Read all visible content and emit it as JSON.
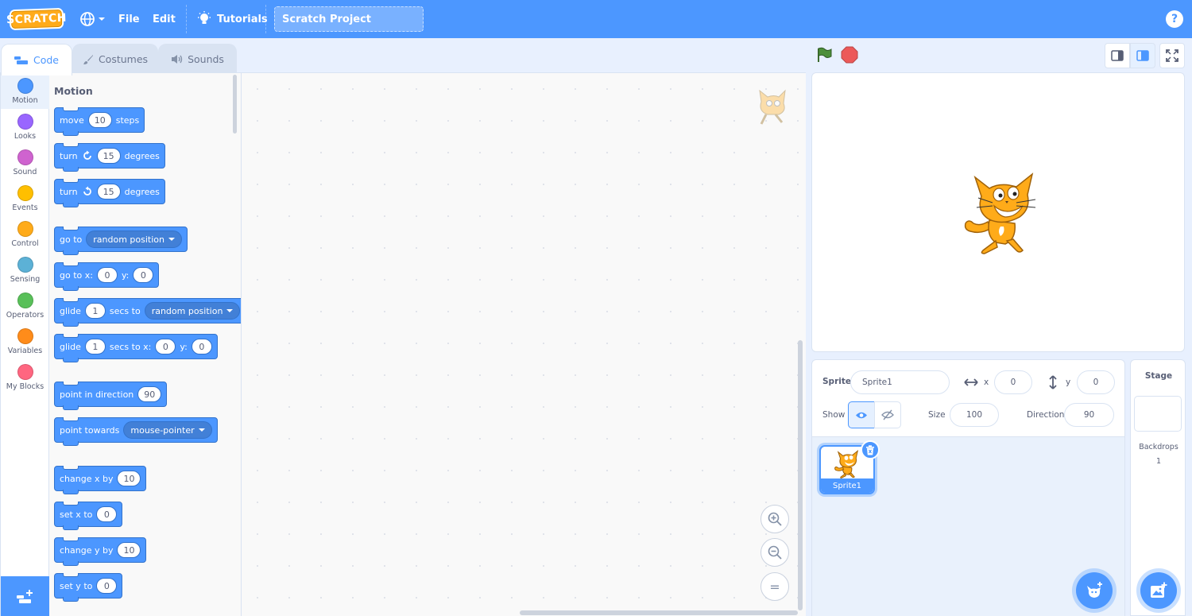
{
  "menubar": {
    "logo_text": "SCRATCH",
    "file": "File",
    "edit": "Edit",
    "tutorials": "Tutorials",
    "project_title": "Scratch Project",
    "help": "?"
  },
  "tabs": [
    {
      "label": "Code",
      "icon": "code-icon"
    },
    {
      "label": "Costumes",
      "icon": "brush-icon"
    },
    {
      "label": "Sounds",
      "icon": "speaker-icon"
    }
  ],
  "categories": [
    {
      "label": "Motion",
      "color": "#4c97ff"
    },
    {
      "label": "Looks",
      "color": "#9966ff"
    },
    {
      "label": "Sound",
      "color": "#cf63cf"
    },
    {
      "label": "Events",
      "color": "#ffbf00"
    },
    {
      "label": "Control",
      "color": "#ffab19"
    },
    {
      "label": "Sensing",
      "color": "#5cb1d6"
    },
    {
      "label": "Operators",
      "color": "#59c059"
    },
    {
      "label": "Variables",
      "color": "#ff8c1a"
    },
    {
      "label": "My Blocks",
      "color": "#ff6680"
    }
  ],
  "palette": {
    "title": "Motion",
    "blocks": {
      "move": {
        "a": "move",
        "v": "10",
        "b": "steps"
      },
      "turn_right": {
        "a": "turn",
        "v": "15",
        "b": "degrees"
      },
      "turn_left": {
        "a": "turn",
        "v": "15",
        "b": "degrees"
      },
      "goto": {
        "a": "go to",
        "d": "random position"
      },
      "goto_xy": {
        "a": "go to x:",
        "x": "0",
        "b": "y:",
        "y": "0"
      },
      "glide_to": {
        "a": "glide",
        "v": "1",
        "b": "secs to",
        "d": "random position"
      },
      "glide_xy": {
        "a": "glide",
        "v": "1",
        "b": "secs to x:",
        "x": "0",
        "c": "y:",
        "y": "0"
      },
      "point_dir": {
        "a": "point in direction",
        "v": "90"
      },
      "point_towards": {
        "a": "point towards",
        "d": "mouse-pointer"
      },
      "change_x": {
        "a": "change x by",
        "v": "10"
      },
      "set_x": {
        "a": "set x to",
        "v": "0"
      },
      "change_y": {
        "a": "change y by",
        "v": "10"
      },
      "set_y": {
        "a": "set y to",
        "v": "0"
      }
    }
  },
  "zoom": {
    "in": "+",
    "out": "−",
    "reset": "="
  },
  "sprite_info": {
    "sprite_label": "Sprite",
    "sprite_name": "Sprite1",
    "x_label": "x",
    "x_value": "0",
    "y_label": "y",
    "y_value": "0",
    "show_label": "Show",
    "size_label": "Size",
    "size_value": "100",
    "direction_label": "Direction",
    "direction_value": "90"
  },
  "sprite_list": [
    {
      "name": "Sprite1"
    }
  ],
  "stage_panel": {
    "title": "Stage",
    "backdrops_label": "Backdrops",
    "backdrops_count": "1"
  }
}
